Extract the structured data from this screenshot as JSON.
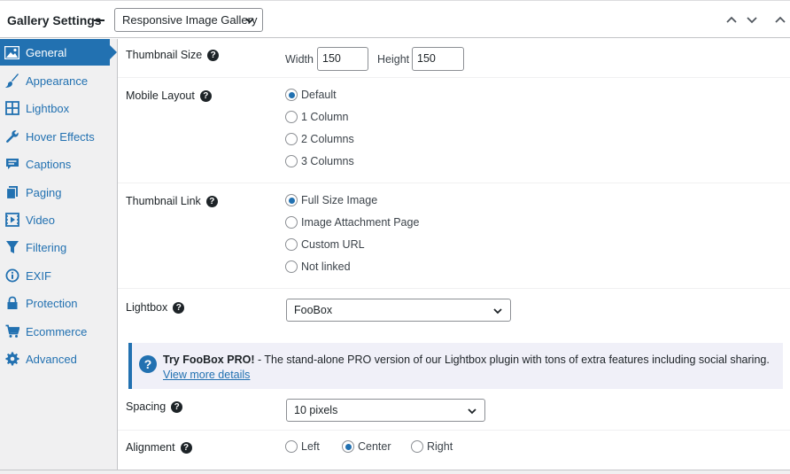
{
  "header": {
    "title": "Gallery Settings",
    "template": "Responsive Image Gallery"
  },
  "sidebar": {
    "items": [
      {
        "label": "General",
        "icon": "image-icon",
        "active": true
      },
      {
        "label": "Appearance",
        "icon": "brush-icon"
      },
      {
        "label": "Lightbox",
        "icon": "grid-icon"
      },
      {
        "label": "Hover Effects",
        "icon": "wrench-icon"
      },
      {
        "label": "Captions",
        "icon": "caption-icon"
      },
      {
        "label": "Paging",
        "icon": "pages-icon"
      },
      {
        "label": "Video",
        "icon": "video-icon"
      },
      {
        "label": "Filtering",
        "icon": "filter-icon"
      },
      {
        "label": "EXIF",
        "icon": "info-icon"
      },
      {
        "label": "Protection",
        "icon": "lock-icon"
      },
      {
        "label": "Ecommerce",
        "icon": "cart-icon"
      },
      {
        "label": "Advanced",
        "icon": "gear-icon"
      }
    ]
  },
  "settings": {
    "thumbnail_size": {
      "label": "Thumbnail Size",
      "width_label": "Width",
      "width_value": "150",
      "height_label": "Height",
      "height_value": "150"
    },
    "mobile_layout": {
      "label": "Mobile Layout",
      "options": [
        "Default",
        "1 Column",
        "2 Columns",
        "3 Columns"
      ],
      "selected": 0
    },
    "thumbnail_link": {
      "label": "Thumbnail Link",
      "options": [
        "Full Size Image",
        "Image Attachment Page",
        "Custom URL",
        "Not linked"
      ],
      "selected": 0
    },
    "lightbox": {
      "label": "Lightbox",
      "value": "FooBox"
    },
    "notice": {
      "title": "Try FooBox PRO!",
      "text": " - The stand-alone PRO version of our Lightbox plugin with tons of extra features including social sharing.",
      "link": "View more details"
    },
    "spacing": {
      "label": "Spacing",
      "value": "10 pixels"
    },
    "alignment": {
      "label": "Alignment",
      "options": [
        "Left",
        "Center",
        "Right"
      ],
      "selected": 1
    }
  },
  "colors": {
    "accent": "#2271b1",
    "sidebar_bg": "#f0f0f1",
    "notice_bg": "#f0f0f8"
  }
}
